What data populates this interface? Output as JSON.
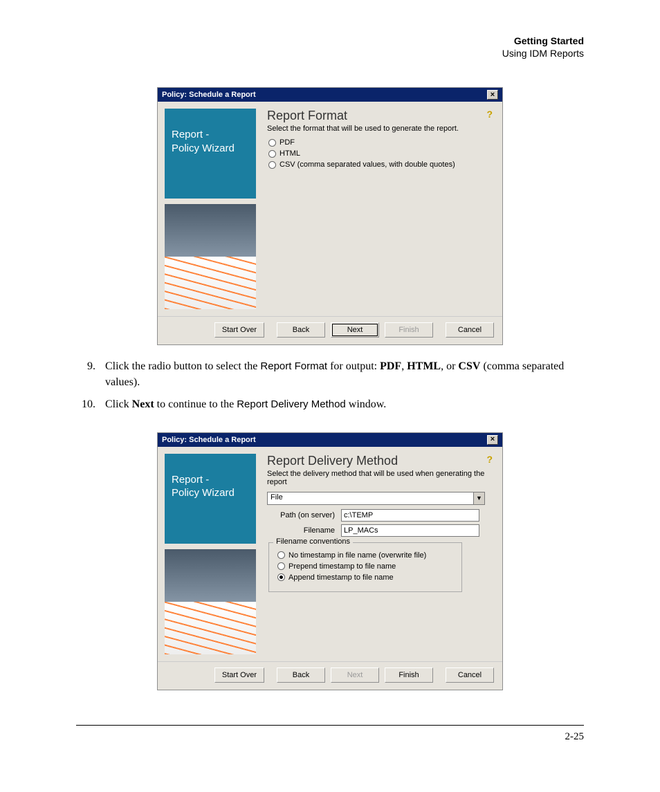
{
  "header": {
    "title": "Getting Started",
    "subtitle": "Using IDM Reports"
  },
  "dialog1": {
    "title": "Policy: Schedule a Report",
    "sideTitle1": "Report -",
    "sideTitle2": "Policy Wizard",
    "heading": "Report Format",
    "sub": "Select the format that will be used to generate the report.",
    "radios": {
      "pdf": "PDF",
      "html": "HTML",
      "csv": "CSV (comma separated values, with double quotes)"
    },
    "buttons": {
      "startover": "Start Over",
      "back": "Back",
      "next": "Next",
      "finish": "Finish",
      "cancel": "Cancel"
    }
  },
  "steps": {
    "s9": {
      "num": "9.",
      "pre": "Click the radio button to select the ",
      "rf": "Report Format",
      "mid": " for output: ",
      "pdf": "PDF",
      "c1": ", ",
      "html": "HTML",
      "c2": ", or ",
      "csv": "CSV",
      "post": " (comma separated values)."
    },
    "s10": {
      "num": "10.",
      "pre": "Click ",
      "next": "Next",
      "mid": " to continue to the ",
      "rdm": "Report Delivery Method",
      "post": " window."
    }
  },
  "dialog2": {
    "title": "Policy: Schedule a Report",
    "sideTitle1": "Report -",
    "sideTitle2": "Policy Wizard",
    "heading": "Report Delivery Method",
    "sub": "Select the delivery method that will be used when generating the report",
    "ddValue": "File",
    "pathLabel": "Path (on server)",
    "pathValue": "c:\\TEMP",
    "fileLabel": "Filename",
    "fileValue": "LP_MACs",
    "fsLegend": "Filename conventions",
    "radios": {
      "r1": "No timestamp in file name (overwrite file)",
      "r2": "Prepend timestamp to file name",
      "r3": "Append timestamp to file name"
    },
    "buttons": {
      "startover": "Start Over",
      "back": "Back",
      "next": "Next",
      "finish": "Finish",
      "cancel": "Cancel"
    }
  },
  "pageNum": "2-25"
}
